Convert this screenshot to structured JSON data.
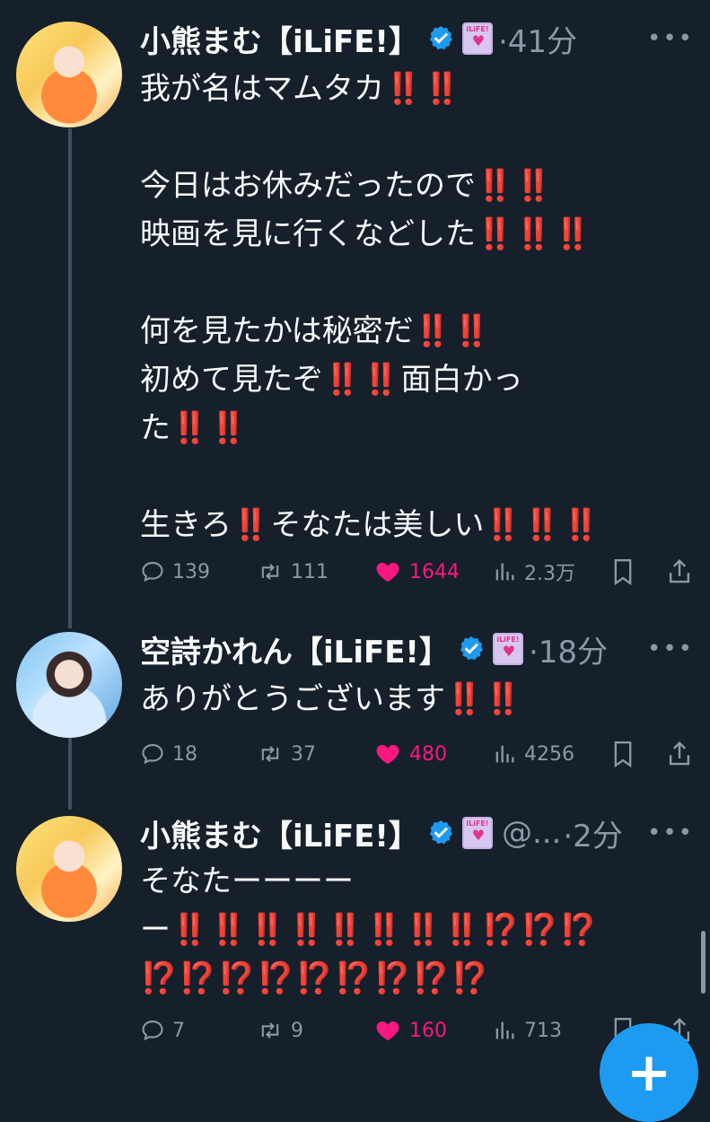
{
  "tweets": [
    {
      "name": "小熊まむ【iLiFE!】",
      "badge_text": "iLiFE!",
      "handle": "",
      "time": "·41分",
      "lines": [
        [
          {
            "t": "我が名はマムタカ"
          },
          {
            "t": "‼️‼️",
            "ex": true
          }
        ],
        [],
        [
          {
            "t": "今日はお休みだったので"
          },
          {
            "t": "‼️‼️",
            "ex": true
          }
        ],
        [
          {
            "t": "映画を見に行くなどした"
          },
          {
            "t": "‼️‼️‼️",
            "ex": true
          }
        ],
        [],
        [
          {
            "t": "何を見たかは秘密だ"
          },
          {
            "t": "‼️‼️",
            "ex": true
          }
        ],
        [
          {
            "t": "初めて見たぞ"
          },
          {
            "t": "‼️‼️",
            "ex": true
          },
          {
            "t": "面白かっ"
          }
        ],
        [
          {
            "t": "た"
          },
          {
            "t": "‼️‼️",
            "ex": true
          }
        ],
        [],
        [
          {
            "t": "生きろ"
          },
          {
            "t": "‼️",
            "ex": true
          },
          {
            "t": "そなたは美しい"
          },
          {
            "t": "‼️‼️‼️",
            "ex": true
          }
        ]
      ],
      "replies": "139",
      "retweets": "111",
      "likes": "1644",
      "views": "2.3万"
    },
    {
      "name": "空詩かれん【iLiFE!】",
      "badge_text": "iLiFE!",
      "handle": "",
      "time": "·18分",
      "lines": [
        [
          {
            "t": "ありがとうございます"
          },
          {
            "t": "‼️‼️",
            "ex": true
          }
        ]
      ],
      "replies": "18",
      "retweets": "37",
      "likes": "480",
      "views": "4256"
    },
    {
      "name": "小熊まむ【iLiFE!】",
      "badge_text": "iLiFE!",
      "handle": "@...",
      "time": "·2分",
      "lines": [
        [
          {
            "t": "そなたーーーー"
          }
        ],
        [
          {
            "t": "ー"
          },
          {
            "t": "‼️‼️‼️‼️‼️‼️‼️‼️⁉️⁉️⁉️",
            "ex": true
          }
        ],
        [
          {
            "t": "⁉️⁉️⁉️⁉️⁉️⁉️⁉️⁉️⁉️",
            "ex": true
          }
        ]
      ],
      "replies": "7",
      "retweets": "9",
      "likes": "160",
      "views": "713"
    }
  ],
  "fab_label": "+",
  "colors": {
    "background": "#15202b",
    "accent": "#1d9bf0",
    "like": "#f91880",
    "muted": "#8b98a5",
    "exclaim": "#e5291c"
  }
}
